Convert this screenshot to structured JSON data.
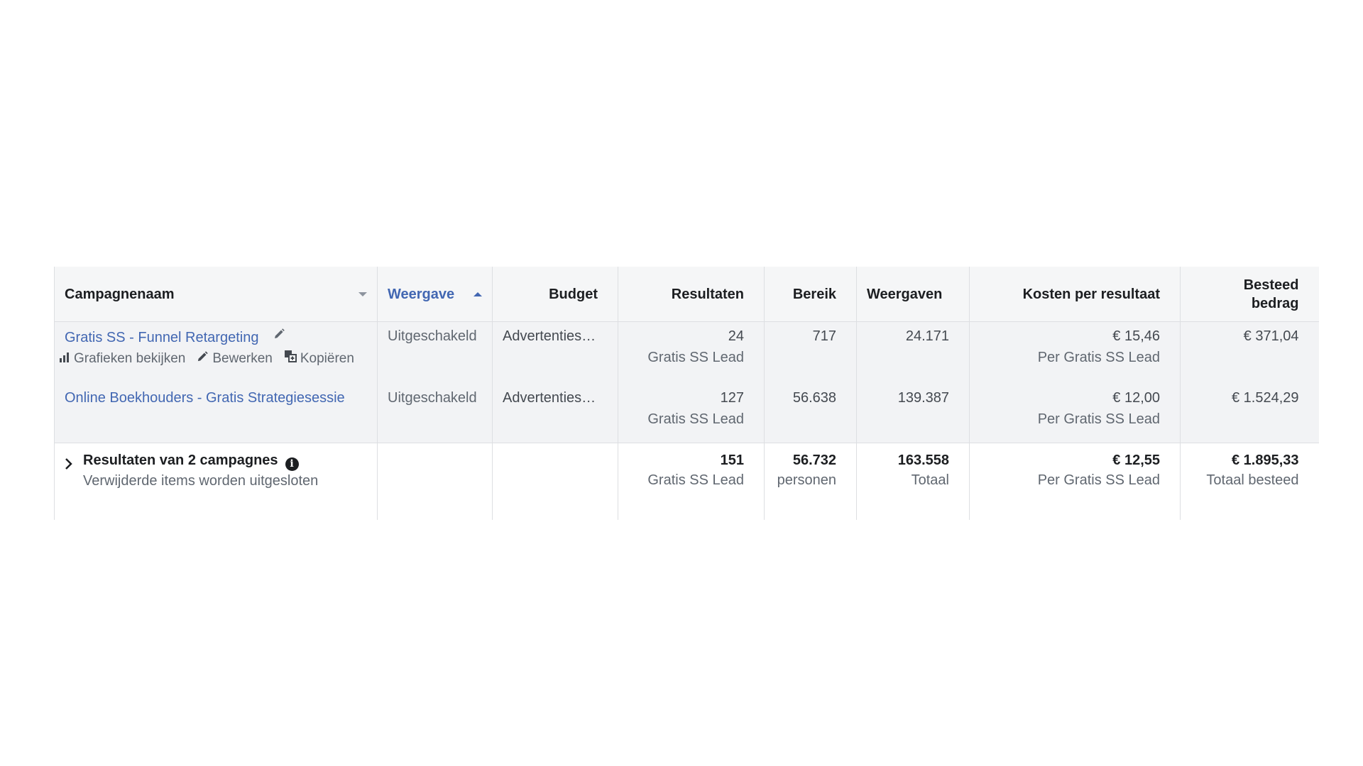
{
  "columns": {
    "name": "Campagnenaam",
    "delivery": "Weergave",
    "budget": "Budget",
    "results": "Resultaten",
    "reach": "Bereik",
    "impressions": "Weergaven",
    "cost_per_result": "Kosten per resultaat",
    "amount_spent_line1": "Besteed",
    "amount_spent_line2": "bedrag"
  },
  "row_actions": {
    "view_charts": "Grafieken bekijken",
    "edit": "Bewerken",
    "duplicate": "Kopiëren"
  },
  "rows": [
    {
      "name": "Gratis SS - Funnel Retargeting",
      "delivery": "Uitgeschakeld",
      "budget": "Advertentiese...",
      "results": "24",
      "results_sub": "Gratis SS Lead",
      "reach": "717",
      "impressions": "24.171",
      "cost_per_result": "€ 15,46",
      "cost_sub": "Per Gratis SS Lead",
      "amount_spent": "€ 371,04"
    },
    {
      "name": "Online Boekhouders - Gratis Strategiesessie",
      "delivery": "Uitgeschakeld",
      "budget": "Advertentiese...",
      "results": "127",
      "results_sub": "Gratis SS Lead",
      "reach": "56.638",
      "impressions": "139.387",
      "cost_per_result": "€ 12,00",
      "cost_sub": "Per Gratis SS Lead",
      "amount_spent": "€ 1.524,29"
    }
  ],
  "summary": {
    "title": "Resultaten van 2 campagnes",
    "subtitle": "Verwijderde items worden uitgesloten",
    "results": "151",
    "results_sub": "Gratis SS Lead",
    "reach": "56.732",
    "reach_sub": "personen",
    "impressions": "163.558",
    "impressions_sub": "Totaal",
    "cost_per_result": "€ 12,55",
    "cost_sub": "Per Gratis SS Lead",
    "amount_spent": "€ 1.895,33",
    "amount_spent_sub": "Totaal besteed"
  },
  "colors": {
    "link": "#4267b2",
    "header_bg": "#f5f6f7",
    "row_bg": "#f2f3f5",
    "border": "#dddfe2"
  }
}
